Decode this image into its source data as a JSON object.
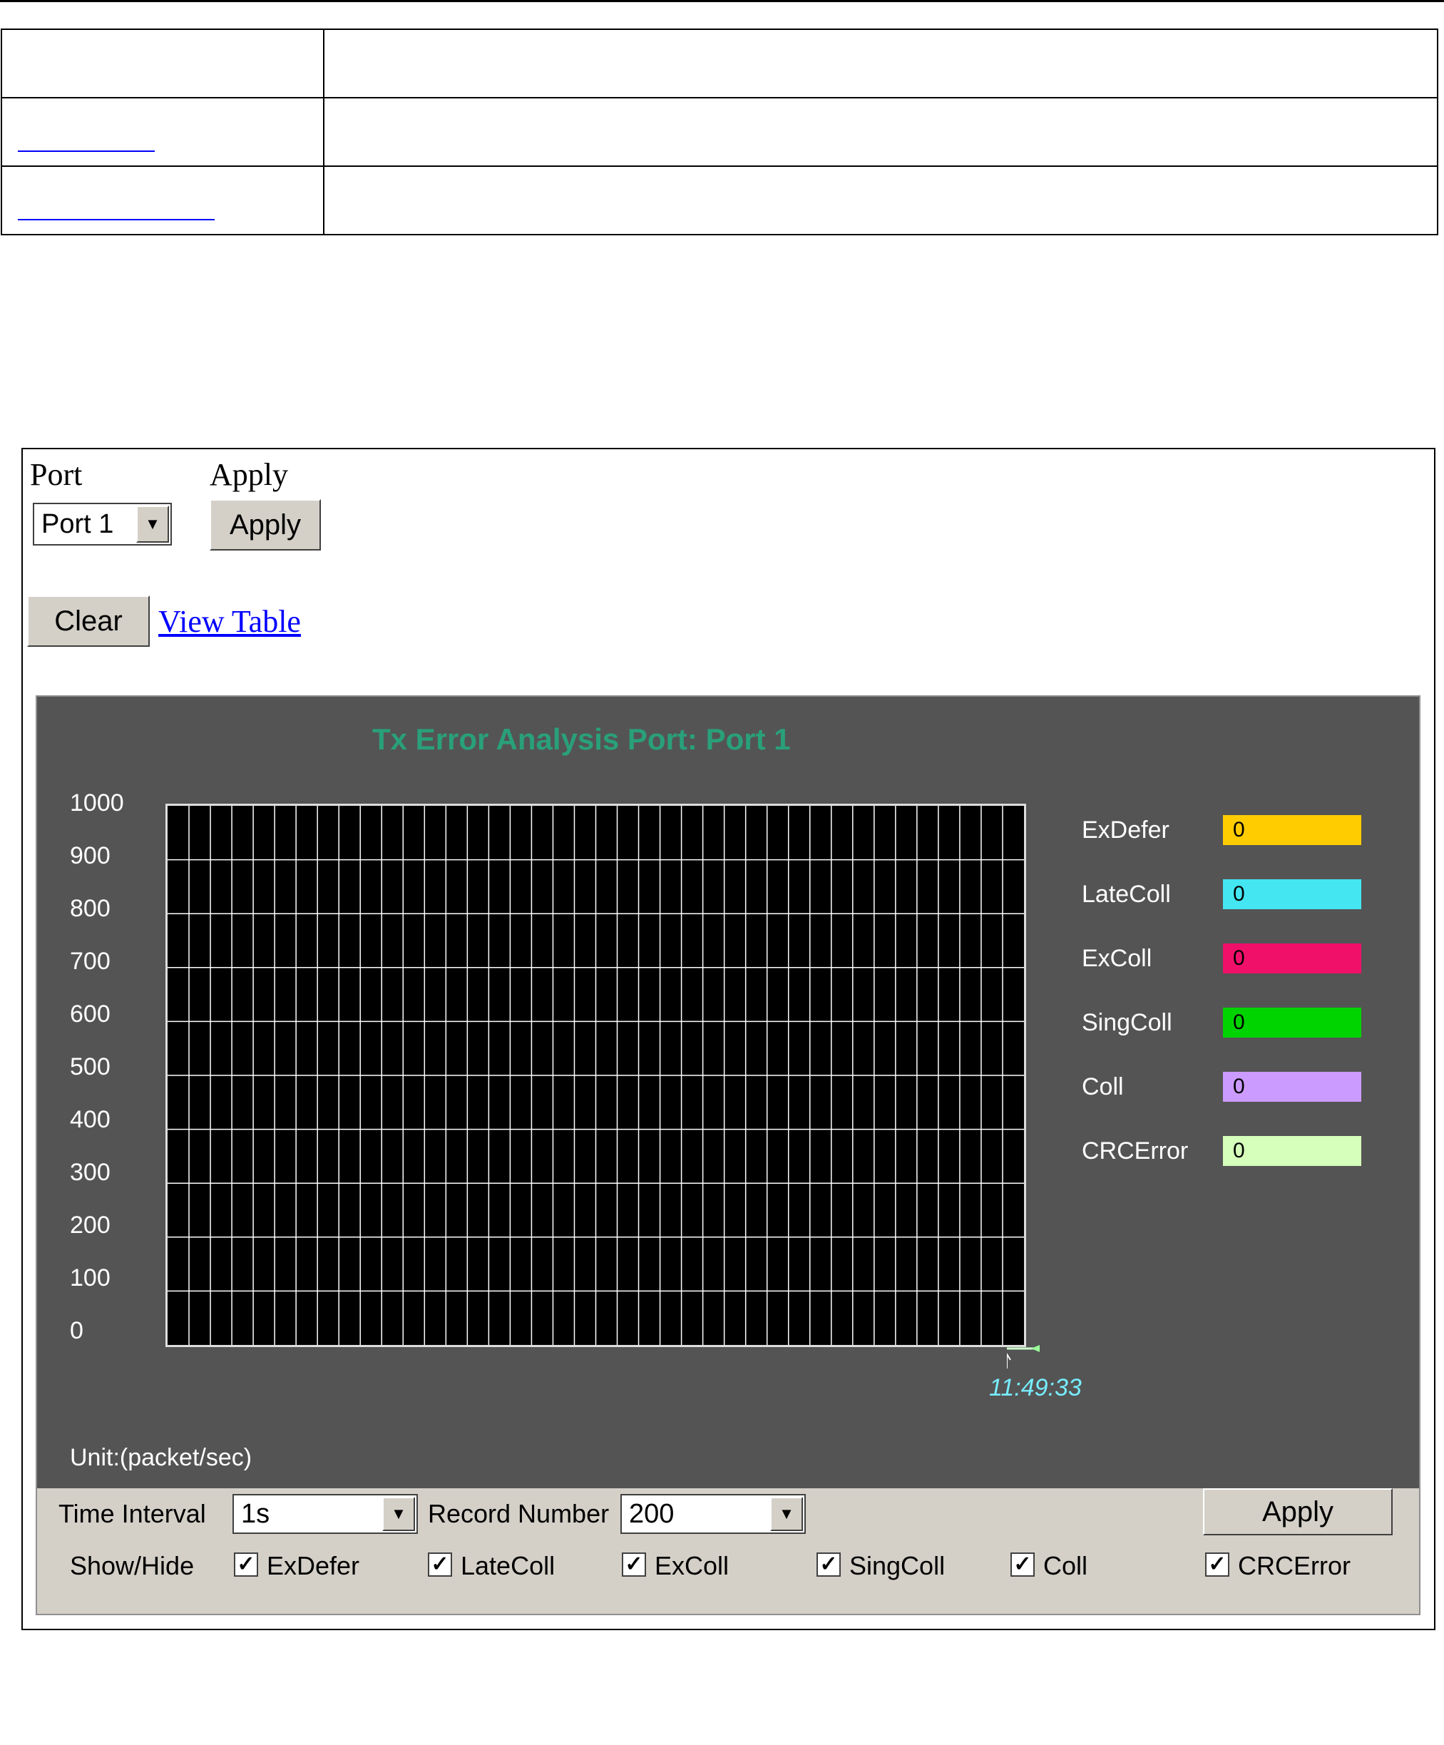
{
  "toolbar": {
    "port_label": "Port",
    "apply_label": "Apply",
    "port_value": "Port 1",
    "apply_button": "Apply",
    "clear_button": "Clear",
    "view_table_link": "View Table"
  },
  "chart": {
    "title": "Tx Error Analysis  Port: Port 1",
    "y_ticks": [
      "1000",
      "900",
      "800",
      "700",
      "600",
      "500",
      "400",
      "300",
      "200",
      "100",
      "0"
    ],
    "unit": "Unit:(packet/sec)",
    "time": "11:49:33"
  },
  "legend": [
    {
      "name": "ExDefer",
      "value": "0",
      "color": "#FFCC00"
    },
    {
      "name": "LateColl",
      "value": "0",
      "color": "#44E6F2"
    },
    {
      "name": "ExColl",
      "value": "0",
      "color": "#F0106A"
    },
    {
      "name": "SingColl",
      "value": "0",
      "color": "#00D400"
    },
    {
      "name": "Coll",
      "value": "0",
      "color": "#CC9BFF"
    },
    {
      "name": "CRCError",
      "value": "0",
      "color": "#D5FFBB"
    }
  ],
  "controls": {
    "time_interval_label": "Time Interval",
    "time_interval_value": "1s",
    "record_number_label": "Record Number",
    "record_number_value": "200",
    "apply_button": "Apply",
    "show_hide_label": "Show/Hide",
    "checkboxes": [
      "ExDefer",
      "LateColl",
      "ExColl",
      "SingColl",
      "Coll",
      "CRCError"
    ]
  },
  "chart_data": {
    "type": "line",
    "title": "Tx Error Analysis  Port: Port 1",
    "ylim": [
      0,
      1000
    ],
    "x": [
      "11:49:33"
    ],
    "series": [
      {
        "name": "ExDefer",
        "values": [
          0
        ]
      },
      {
        "name": "LateColl",
        "values": [
          0
        ]
      },
      {
        "name": "ExColl",
        "values": [
          0
        ]
      },
      {
        "name": "SingColl",
        "values": [
          0
        ]
      },
      {
        "name": "Coll",
        "values": [
          0
        ]
      },
      {
        "name": "CRCError",
        "values": [
          0
        ]
      }
    ]
  }
}
